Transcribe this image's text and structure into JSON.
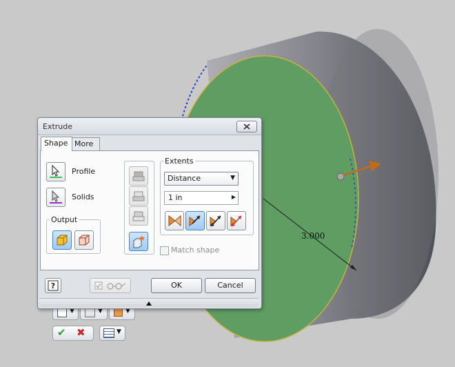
{
  "viewport": {
    "dimension_value": "3.000",
    "face_color": "#5f9d62",
    "body_color": "#8f9096"
  },
  "dialog": {
    "title": "Extrude",
    "tabs": [
      {
        "label": "Shape",
        "active": true
      },
      {
        "label": "More",
        "active": false
      }
    ],
    "profile_label": "Profile",
    "solids_label": "Solids",
    "output_group": "Output",
    "extents_group": "Extents",
    "extents_type": "Distance",
    "distance_value": "1 in",
    "match_shape_label": "Match shape",
    "ok_label": "OK",
    "cancel_label": "Cancel"
  },
  "mini_toolbar": {
    "icons": [
      "profile-menu-icon",
      "solids-menu-icon",
      "output-menu-icon",
      "apply-icon",
      "cancel-icon",
      "options-menu-icon"
    ]
  },
  "colors": {
    "accent_pressed": "#9fcaf2",
    "ok_green": "#2e9a3a",
    "cancel_red": "#c8282a",
    "preview_arrow": "#c06a1c"
  }
}
